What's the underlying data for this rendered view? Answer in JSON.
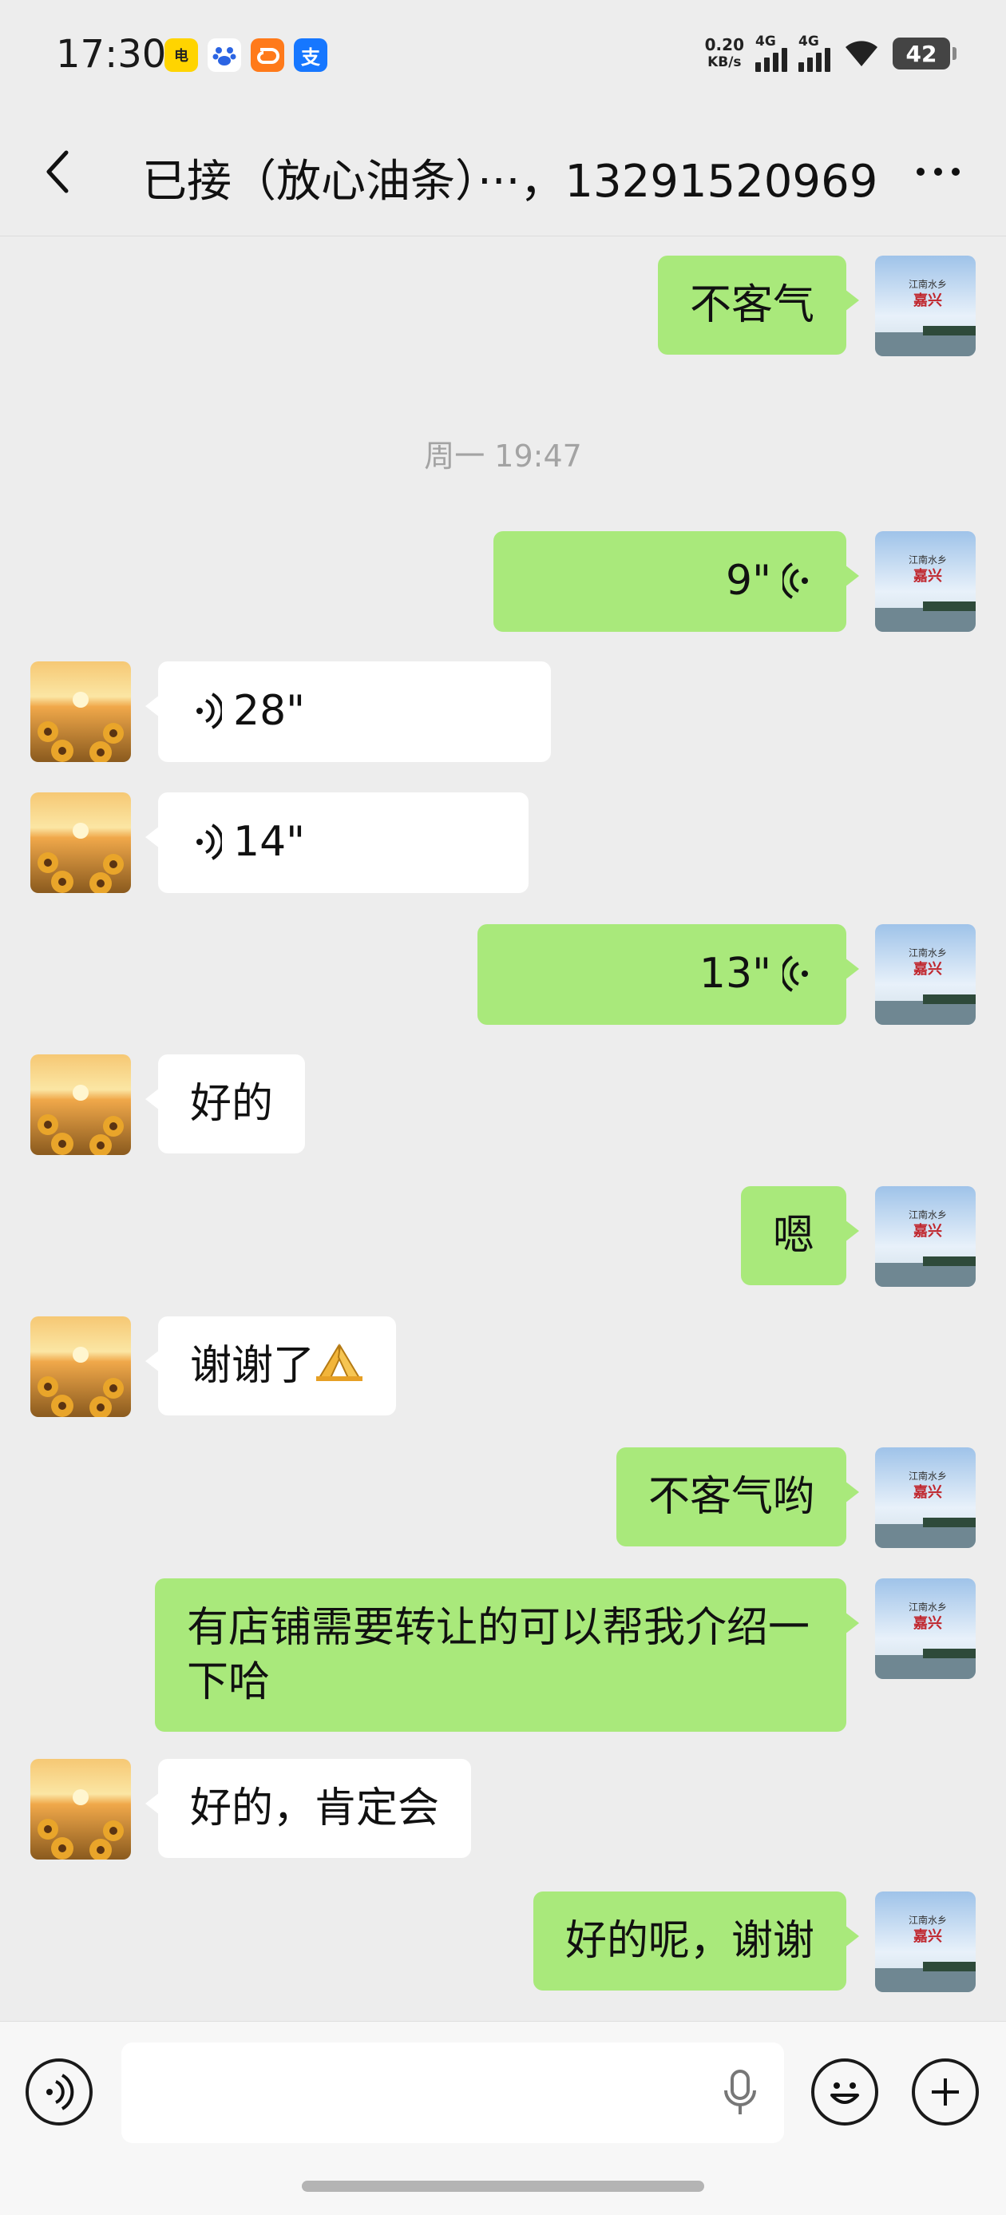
{
  "status_bar": {
    "time": "17:30",
    "net_speed_value": "0.20",
    "net_speed_unit": "KB/s",
    "signal_1_label": "4G",
    "signal_2_label": "4G",
    "battery": "42",
    "app_icon_1": "电",
    "app_icon_4": "支"
  },
  "header": {
    "title": "已接（放心油条）···，13291520969"
  },
  "messages": {
    "m1": "不客气",
    "timestamp": "周一 19:47",
    "m2_duration": "9\"",
    "m3_duration": "28\"",
    "m4_duration": "14\"",
    "m5_duration": "13\"",
    "m6": "好的",
    "m7": "嗯",
    "m8": "谢谢了",
    "m9": "不客气哟",
    "m10": "有店铺需要转让的可以帮我介绍一下哈",
    "m11": "好的，肯定会",
    "m12": "好的呢，谢谢"
  },
  "avatars": {
    "me_line1": "江南水乡",
    "me_line2": "嘉兴"
  },
  "colors": {
    "my_bubble": "#a9e97b",
    "their_bubble": "#ffffff",
    "background": "#ededed"
  }
}
